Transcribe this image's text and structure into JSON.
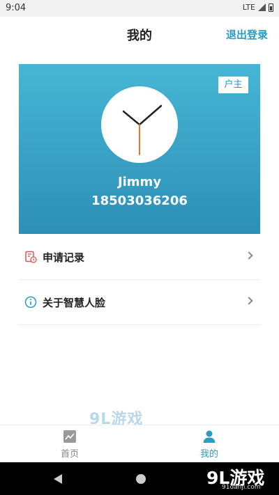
{
  "status_bar": {
    "time": "9:04",
    "network": "LTE"
  },
  "header": {
    "title": "我的",
    "logout_label": "退出登录"
  },
  "profile": {
    "role_badge": "户主",
    "name": "Jimmy",
    "phone": "18503036206"
  },
  "menu": {
    "items": [
      {
        "label": "申请记录",
        "icon": "document-clock-icon"
      },
      {
        "label": "关于智慧人脸",
        "icon": "info-icon"
      }
    ]
  },
  "bottom_nav": {
    "items": [
      {
        "label": "首页",
        "icon": "chart-icon",
        "active": false
      },
      {
        "label": "我的",
        "icon": "person-icon",
        "active": true
      }
    ]
  },
  "watermark": {
    "text": "9L游戏",
    "sub": "91danji.com"
  },
  "colors": {
    "accent": "#2b9bc1",
    "card_top": "#47b6d5",
    "card_bottom": "#2d8fb6"
  }
}
